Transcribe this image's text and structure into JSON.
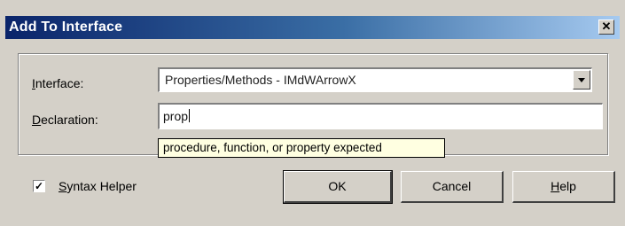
{
  "window": {
    "title": "Add To Interface",
    "close_glyph": "✕"
  },
  "form": {
    "interface_label_accel": "I",
    "interface_label_rest": "nterface:",
    "interface_value": "Properties/Methods - IMdWArrowX",
    "declaration_label_accel": "D",
    "declaration_label_rest": "eclaration:",
    "declaration_value": "prop",
    "tooltip": "procedure, function, or property expected"
  },
  "options": {
    "syntax_helper_checked": true,
    "syntax_helper_check_glyph": "✓",
    "syntax_helper_accel": "S",
    "syntax_helper_rest": "yntax Helper"
  },
  "buttons": {
    "ok": "OK",
    "cancel": "Cancel",
    "help_accel": "H",
    "help_rest": "elp"
  },
  "icons": [
    "close-icon",
    "dropdown-arrow-icon",
    "checkmark-icon"
  ]
}
